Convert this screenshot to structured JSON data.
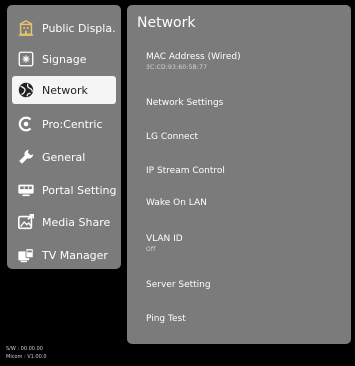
{
  "sidebar": {
    "items": [
      {
        "label": "Public Displa...",
        "icon": "building-icon"
      },
      {
        "label": "Signage",
        "icon": "signage-icon"
      },
      {
        "label": "Network",
        "icon": "globe-icon"
      },
      {
        "label": "Pro:Centric",
        "icon": "procentric-icon"
      },
      {
        "label": "General",
        "icon": "wrench-icon"
      },
      {
        "label": "Portal Settings",
        "icon": "portal-icon"
      },
      {
        "label": "Media Share",
        "icon": "media-share-icon"
      },
      {
        "label": "TV Manager",
        "icon": "tv-manager-icon"
      }
    ],
    "selected": "Network"
  },
  "panel": {
    "title": "Network",
    "items": [
      {
        "label": "MAC Address (Wired)",
        "value": "3C:CD:93:60:5B:77"
      },
      {
        "label": "Network Settings"
      },
      {
        "label": "LG Connect"
      },
      {
        "label": "IP Stream Control"
      },
      {
        "label": "Wake On LAN"
      },
      {
        "label": "VLAN ID",
        "value": "Off"
      },
      {
        "label": "Server Setting"
      },
      {
        "label": "Ping Test"
      }
    ]
  },
  "footer": {
    "sw": "S/W : 00.00.00",
    "micom": "Micom : V1.00.0"
  },
  "colors": {
    "panel_bg": "#7b7b7b",
    "page_bg": "#000000",
    "selected_bg": "#f5f5f5",
    "accent_icon": "#e8c470"
  }
}
